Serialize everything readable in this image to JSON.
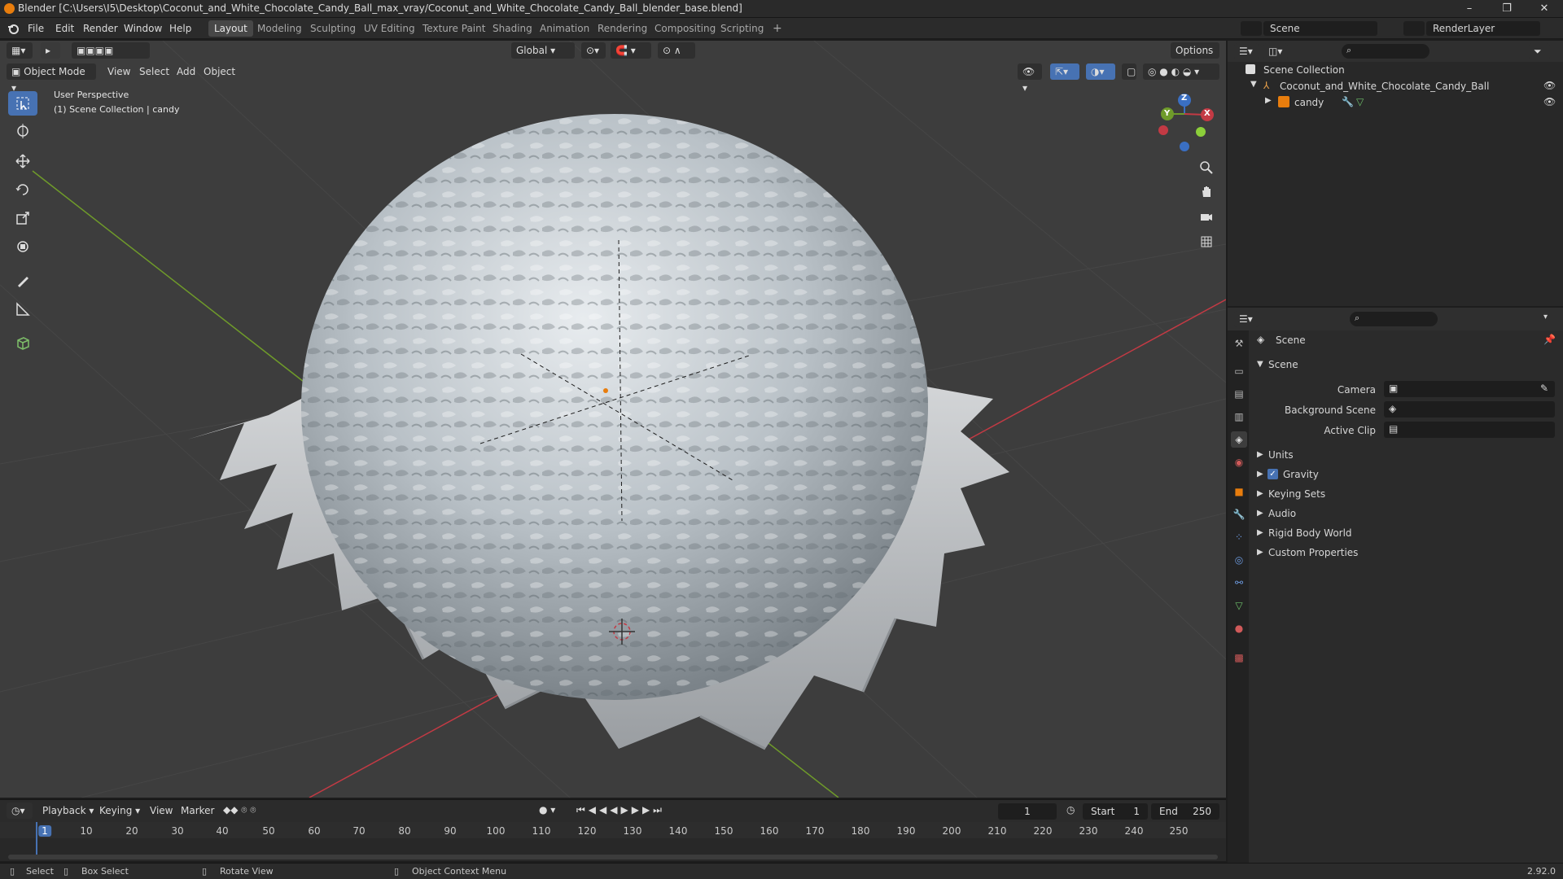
{
  "window": {
    "title": "Blender [C:\\Users\\I5\\Desktop\\Coconut_and_White_Chocolate_Candy_Ball_max_vray/Coconut_and_White_Chocolate_Candy_Ball_blender_base.blend]",
    "controls": {
      "minimize": "–",
      "maximize": "❐",
      "close": "✕"
    }
  },
  "menu": {
    "items": [
      "File",
      "Edit",
      "Render",
      "Window",
      "Help"
    ]
  },
  "workspaces": [
    "Layout",
    "Modeling",
    "Sculpting",
    "UV Editing",
    "Texture Paint",
    "Shading",
    "Animation",
    "Rendering",
    "Compositing",
    "Scripting"
  ],
  "workspace_add": "+",
  "scene_selector": {
    "label": "Scene",
    "layer": "RenderLayer"
  },
  "viewport": {
    "mode": "Object Mode",
    "menus": [
      "View",
      "Select",
      "Add",
      "Object"
    ],
    "transform_orientation": "Global",
    "options": "Options",
    "overlay_text": [
      "User Perspective",
      "(1) Scene Collection | candy"
    ],
    "gizmo": {
      "x": "X",
      "y": "Y",
      "z": "Z"
    }
  },
  "outliner": {
    "root": "Scene Collection",
    "items": [
      {
        "label": "Coconut_and_White_Chocolate_Candy_Ball"
      },
      {
        "label": "candy"
      }
    ]
  },
  "properties": {
    "context": "Scene",
    "panel": "Scene",
    "fields": [
      {
        "label": "Camera"
      },
      {
        "label": "Background Scene"
      },
      {
        "label": "Active Clip"
      }
    ],
    "subpanels": [
      "Units",
      "Gravity",
      "Keying Sets",
      "Audio",
      "Rigid Body World",
      "Custom Properties"
    ]
  },
  "timeline": {
    "menus": [
      "Playback",
      "Keying",
      "View",
      "Marker"
    ],
    "current_frame": "1",
    "start_label": "Start",
    "start": "1",
    "end_label": "End",
    "end": "250",
    "ticks": [
      "1",
      "10",
      "20",
      "30",
      "40",
      "50",
      "60",
      "70",
      "80",
      "90",
      "100",
      "110",
      "120",
      "130",
      "140",
      "150",
      "160",
      "170",
      "180",
      "190",
      "200",
      "210",
      "220",
      "230",
      "240",
      "250"
    ]
  },
  "status": {
    "select": "Select",
    "box_select": "Box Select",
    "rotate": "Rotate View",
    "context_menu": "Object Context Menu",
    "version": "2.92.0"
  },
  "colors": {
    "accent": "#4772b3",
    "axis_x": "#c33a44",
    "axis_y": "#6f9b2a",
    "axis_z": "#3a6fc3",
    "blender_orange": "#e87d0d"
  }
}
